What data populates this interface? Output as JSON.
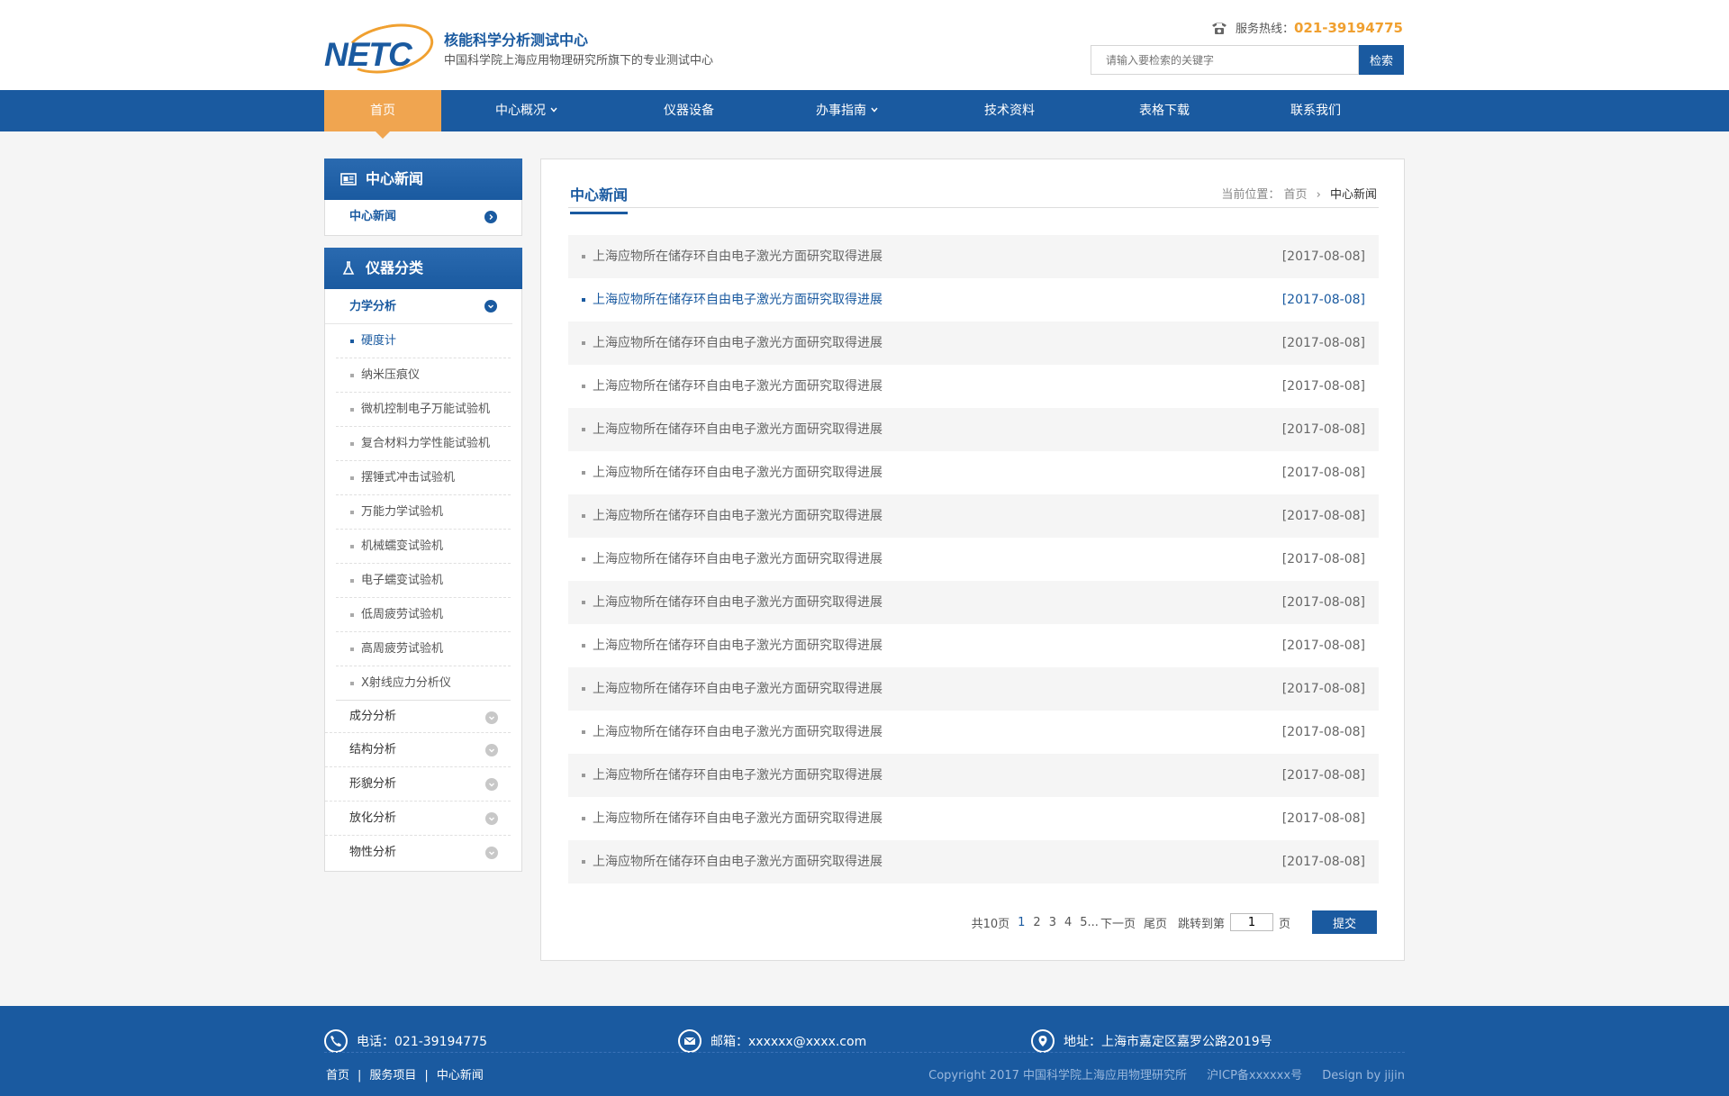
{
  "header": {
    "logo_text": "NETC",
    "title": "核能科学分析测试中心",
    "subtitle": "中国科学院上海应用物理研究所旗下的专业测试中心",
    "hotline_label": "服务热线：",
    "hotline_number": "021-39194775",
    "search_placeholder": "请输入要检索的关键字",
    "search_button": "检索"
  },
  "nav": [
    {
      "label": "首页",
      "active": true
    },
    {
      "label": "中心概况",
      "dropdown": true
    },
    {
      "label": "仪器设备"
    },
    {
      "label": "办事指南",
      "dropdown": true
    },
    {
      "label": "技术资料"
    },
    {
      "label": "表格下载"
    },
    {
      "label": "联系我们"
    }
  ],
  "sidebar": {
    "news_head": "中心新闻",
    "news_item": "中心新闻",
    "category_head": "仪器分类",
    "expanded_category": "力学分析",
    "sub_items": [
      "硬度计",
      "纳米压痕仪",
      "微机控制电子万能试验机",
      "复合材料力学性能试验机",
      "摆锤式冲击试验机",
      "万能力学试验机",
      "机械蠕变试验机",
      "电子蠕变试验机",
      "低周疲劳试验机",
      "高周疲劳试验机",
      "X射线应力分析仪"
    ],
    "categories": [
      "成分分析",
      "结构分析",
      "形貌分析",
      "放化分析",
      "物性分析"
    ]
  },
  "main": {
    "title": "中心新闻",
    "breadcrumb_label": "当前位置：",
    "breadcrumb_home": "首页",
    "breadcrumb_sep": "›",
    "breadcrumb_current": "中心新闻",
    "news": [
      {
        "title": "上海应物所在储存环自由电子激光方面研究取得进展",
        "date": "[2017-08-08]"
      },
      {
        "title": "上海应物所在储存环自由电子激光方面研究取得进展",
        "date": "[2017-08-08]"
      },
      {
        "title": "上海应物所在储存环自由电子激光方面研究取得进展",
        "date": "[2017-08-08]"
      },
      {
        "title": "上海应物所在储存环自由电子激光方面研究取得进展",
        "date": "[2017-08-08]"
      },
      {
        "title": "上海应物所在储存环自由电子激光方面研究取得进展",
        "date": "[2017-08-08]"
      },
      {
        "title": "上海应物所在储存环自由电子激光方面研究取得进展",
        "date": "[2017-08-08]"
      },
      {
        "title": "上海应物所在储存环自由电子激光方面研究取得进展",
        "date": "[2017-08-08]"
      },
      {
        "title": "上海应物所在储存环自由电子激光方面研究取得进展",
        "date": "[2017-08-08]"
      },
      {
        "title": "上海应物所在储存环自由电子激光方面研究取得进展",
        "date": "[2017-08-08]"
      },
      {
        "title": "上海应物所在储存环自由电子激光方面研究取得进展",
        "date": "[2017-08-08]"
      },
      {
        "title": "上海应物所在储存环自由电子激光方面研究取得进展",
        "date": "[2017-08-08]"
      },
      {
        "title": "上海应物所在储存环自由电子激光方面研究取得进展",
        "date": "[2017-08-08]"
      },
      {
        "title": "上海应物所在储存环自由电子激光方面研究取得进展",
        "date": "[2017-08-08]"
      },
      {
        "title": "上海应物所在储存环自由电子激光方面研究取得进展",
        "date": "[2017-08-08]"
      },
      {
        "title": "上海应物所在储存环自由电子激光方面研究取得进展",
        "date": "[2017-08-08]"
      }
    ],
    "pager": {
      "total": "共10页",
      "pages": [
        "1",
        "2",
        "3",
        "4",
        "5"
      ],
      "ellipsis": "...",
      "next": "下一页",
      "last": "尾页",
      "jump_label": "跳转到第",
      "jump_value": "1",
      "page_unit": "页",
      "submit": "提交"
    }
  },
  "footer": {
    "phone": "电话：021-39194775",
    "email": "邮箱：xxxxxx@xxxx.com",
    "address": "地址：上海市嘉定区嘉罗公路2019号",
    "links": [
      "首页",
      "服务项目",
      "中心新闻"
    ],
    "link_sep": "|",
    "copyright": "Copyright 2017  中国科学院上海应用物理研究所",
    "icp": "沪ICP备xxxxxx号",
    "design": "Design by jijin"
  },
  "colors": {
    "primary": "#1a5aa0",
    "accent": "#f0a550",
    "hotline": "#f0a030"
  }
}
